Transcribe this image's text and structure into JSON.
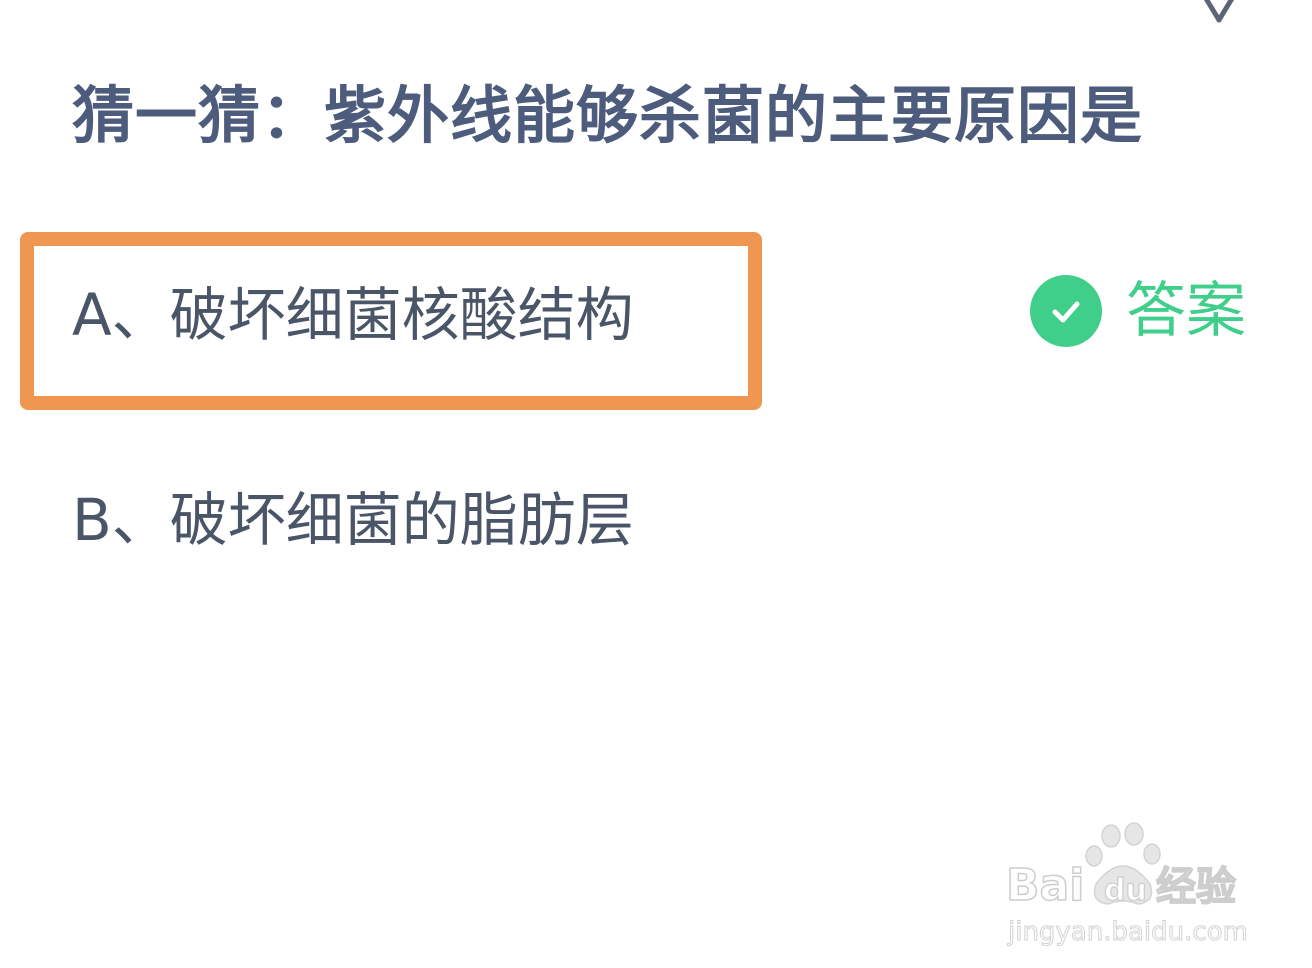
{
  "question": {
    "title": "猜一猜：紫外线能够杀菌的主要原因是"
  },
  "options": [
    {
      "label": "A、破坏细菌核酸结构"
    },
    {
      "label": "B、破坏细菌的脂肪层"
    }
  ],
  "answer": {
    "label": "答案",
    "icon": "check-circle-icon",
    "color": "#3fcf8a"
  },
  "highlight": {
    "color": "#ef9650"
  },
  "close": {
    "icon": "close-icon"
  },
  "watermark": {
    "brand": "Bai du 经验",
    "url": "jingyan.baidu.com"
  }
}
